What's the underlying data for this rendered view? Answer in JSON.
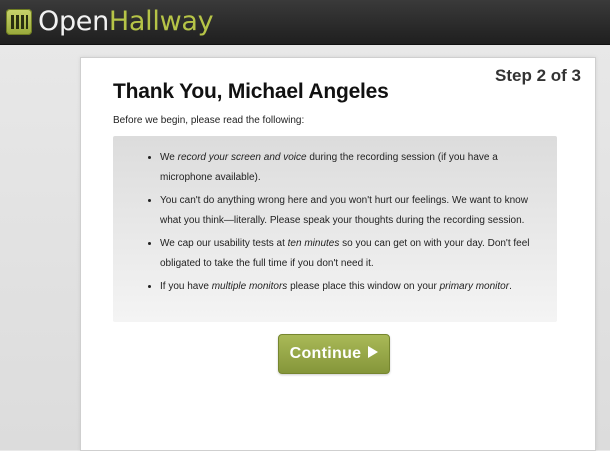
{
  "header": {
    "logo_part1": "Open",
    "logo_part2": "Hallway",
    "logo_icon": "hallway-logo-icon"
  },
  "card": {
    "step": "Step 2 of 3",
    "title": "Thank You, Michael Angeles",
    "intro": "Before we begin, please read the following:",
    "bullets": [
      {
        "pre": "We ",
        "em": "record your screen and voice",
        "post": " during the recording session (if you have a microphone available)."
      },
      {
        "text": "You can't do anything wrong here and you won't hurt our feelings. We want to know what you think—literally. Please speak your thoughts during the recording session."
      },
      {
        "pre": "We cap our usability tests at ",
        "em": "ten minutes",
        "post": " so you can get on with your day. Don't feel obligated to take the full time if you don't need it."
      },
      {
        "pre": "If you have ",
        "em": "multiple monitors",
        "mid": " please place this window on your ",
        "em2": "primary monitor",
        "post": "."
      }
    ],
    "continue_label": "Continue",
    "continue_icon": "play-arrow-icon"
  },
  "colors": {
    "brand_green": "#b6c447",
    "button_green": "#95a646",
    "header_bg": "#2b2b2b"
  }
}
